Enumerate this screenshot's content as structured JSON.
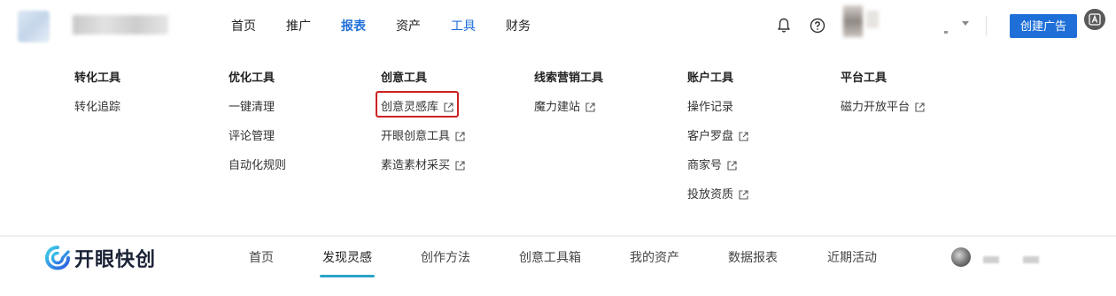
{
  "top_nav": {
    "items": [
      {
        "label": "首页"
      },
      {
        "label": "推广"
      },
      {
        "label": "报表"
      },
      {
        "label": "资产"
      },
      {
        "label": "工具"
      },
      {
        "label": "财务"
      }
    ],
    "active_index": 2,
    "create_button": "创建广告"
  },
  "tools_menu": {
    "columns": [
      {
        "title": "转化工具",
        "items": [
          {
            "label": "转化追踪",
            "external": false
          }
        ]
      },
      {
        "title": "优化工具",
        "items": [
          {
            "label": "一键清理",
            "external": false
          },
          {
            "label": "评论管理",
            "external": false
          },
          {
            "label": "自动化规则",
            "external": false
          }
        ]
      },
      {
        "title": "创意工具",
        "items": [
          {
            "label": "创意灵感库",
            "external": true
          },
          {
            "label": "开眼创意工具",
            "external": true
          },
          {
            "label": "素造素材采买",
            "external": true
          }
        ]
      },
      {
        "title": "线索营销工具",
        "items": [
          {
            "label": "魔力建站",
            "external": true
          }
        ]
      },
      {
        "title": "账户工具",
        "items": [
          {
            "label": "操作记录",
            "external": false
          },
          {
            "label": "客户罗盘",
            "external": true
          },
          {
            "label": "商家号",
            "external": true
          },
          {
            "label": "投放资质",
            "external": true
          }
        ]
      },
      {
        "title": "平台工具",
        "items": [
          {
            "label": "磁力开放平台",
            "external": true
          }
        ]
      }
    ],
    "highlighted_item": "创意灵感库"
  },
  "bottom_nav": {
    "brand": "开眼快创",
    "items": [
      {
        "label": "首页"
      },
      {
        "label": "发现灵感"
      },
      {
        "label": "创作方法"
      },
      {
        "label": "创意工具箱"
      },
      {
        "label": "我的资产"
      },
      {
        "label": "数据报表"
      },
      {
        "label": "近期活动"
      }
    ],
    "active_index": 1
  },
  "colors": {
    "accent": "#1f6fd9",
    "highlight_border": "#cc2222",
    "tab_underline": "#2aa4c8"
  }
}
